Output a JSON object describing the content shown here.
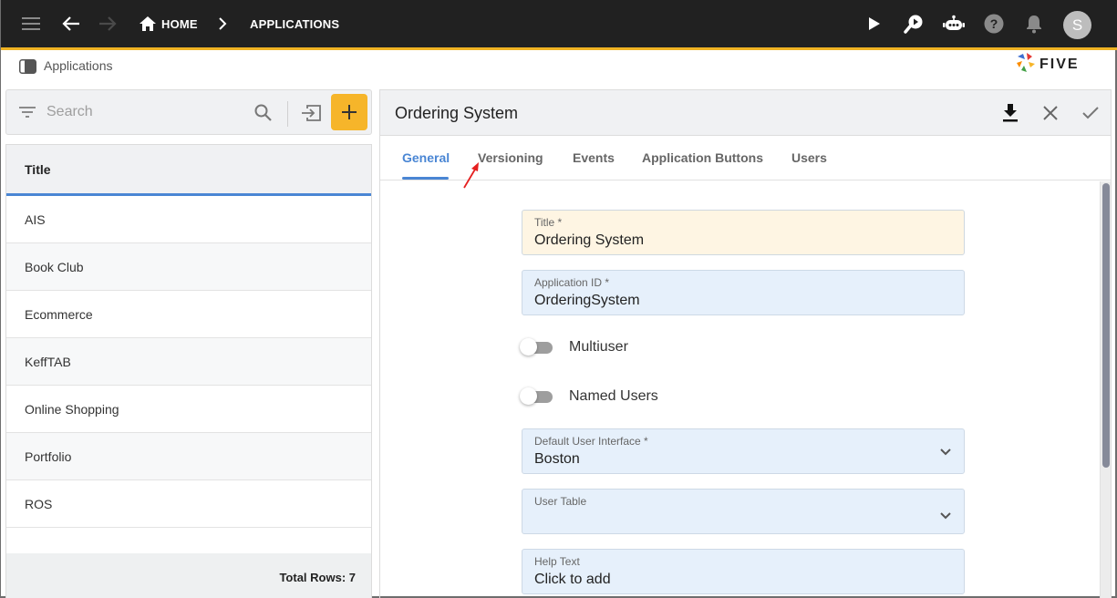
{
  "topbar": {
    "breadcrumbs": [
      "HOME",
      "APPLICATIONS"
    ],
    "avatar_initial": "S",
    "icons": [
      "menu-icon",
      "back-arrow-icon",
      "forward-arrow-icon",
      "home-icon",
      "chevron-right-icon",
      "play-icon",
      "search-play-icon",
      "chat-bot-icon",
      "help-icon",
      "bell-icon"
    ],
    "accent_color": "#f0b323"
  },
  "subheader": {
    "title": "Applications",
    "logo_text": "FIVE"
  },
  "list": {
    "search_placeholder": "Search",
    "column_header": "Title",
    "rows": [
      "AIS",
      "Book Club",
      "Ecommerce",
      "KeffTAB",
      "Online Shopping",
      "Portfolio",
      "ROS"
    ],
    "total_rows_label": "Total Rows: 7",
    "add_button_label": "+",
    "add_button_color": "#f6b52a"
  },
  "form": {
    "title": "Ordering System",
    "tabs": [
      {
        "label": "General",
        "active": true
      },
      {
        "label": "Versioning",
        "active": false
      },
      {
        "label": "Events",
        "active": false
      },
      {
        "label": "Application Buttons",
        "active": false
      },
      {
        "label": "Users",
        "active": false
      }
    ],
    "fields": {
      "title": {
        "label": "Title *",
        "value": "Ordering System"
      },
      "application_id": {
        "label": "Application ID *",
        "value": "OrderingSystem"
      },
      "multiuser": {
        "label": "Multiuser",
        "checked": false
      },
      "named_users": {
        "label": "Named Users",
        "checked": false
      },
      "default_ui": {
        "label": "Default User Interface *",
        "value": "Boston"
      },
      "user_table": {
        "label": "User Table",
        "value": ""
      },
      "help_text": {
        "label": "Help Text",
        "value": "Click to add"
      }
    },
    "active_tab_color": "#4a86d4"
  }
}
